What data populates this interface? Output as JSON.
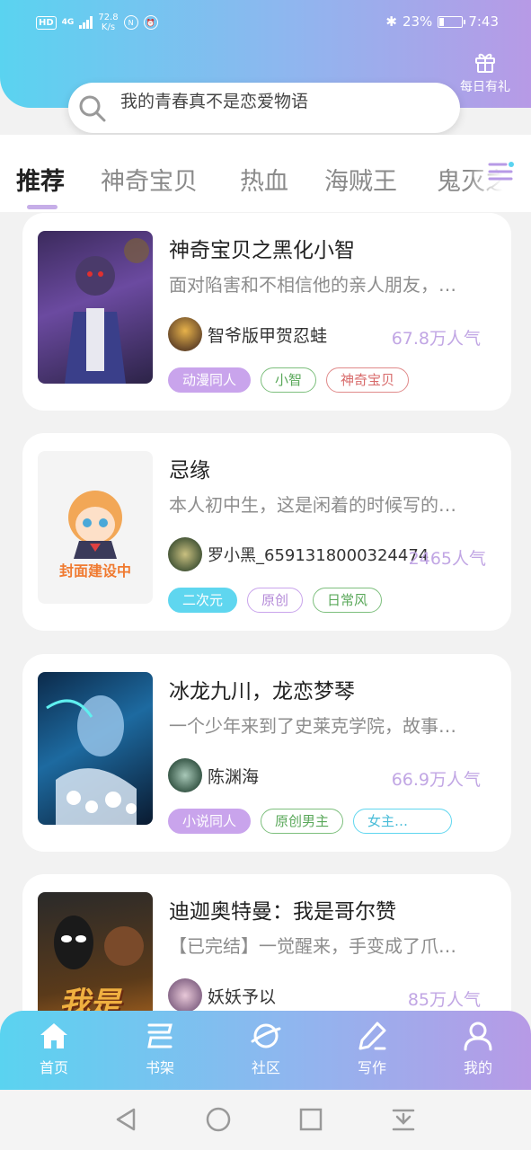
{
  "status_bar": {
    "network_badge": "HD",
    "network_type": "4G",
    "speed_value": "72.8",
    "speed_unit": "K/s",
    "battery": "23%",
    "time": "7:43"
  },
  "header": {
    "gift_label": "每日有礼"
  },
  "search": {
    "placeholder": "我的青春真不是恋爱物语"
  },
  "tabs": [
    {
      "label": "推荐",
      "active": true
    },
    {
      "label": "神奇宝贝",
      "active": false
    },
    {
      "label": "热血",
      "active": false
    },
    {
      "label": "海贼王",
      "active": false
    },
    {
      "label": "鬼灭之刃",
      "active": false
    }
  ],
  "books": [
    {
      "title": "神奇宝贝之黑化小智",
      "desc": "面对陷害和不相信他的亲人朋友，…",
      "author": "智爷版甲贺忍蛙",
      "popularity": "67.8万人气",
      "tags": [
        {
          "label": "动漫同人",
          "style": "fill-purple"
        },
        {
          "label": "小智",
          "style": "out-green"
        },
        {
          "label": "神奇宝贝",
          "style": "out-red"
        }
      ]
    },
    {
      "title": "忌缘",
      "desc": "本人初中生，这是闲着的时候写的…",
      "author": "罗小黑_6591318000324474",
      "popularity": "2465人气",
      "cover_text": "封面建设中",
      "tags": [
        {
          "label": "二次元",
          "style": "fill-cyan"
        },
        {
          "label": "原创",
          "style": "out-purple"
        },
        {
          "label": "日常风",
          "style": "out-green"
        }
      ]
    },
    {
      "title": "冰龙九川，龙恋梦琴",
      "desc": "一个少年来到了史莱克学院，故事…",
      "author": "陈渊海",
      "popularity": "66.9万人气",
      "tags": [
        {
          "label": "小说同人",
          "style": "fill-purple"
        },
        {
          "label": "原创男主",
          "style": "out-green"
        },
        {
          "label": "女主…",
          "style": "out-cyan"
        }
      ]
    },
    {
      "title": "迪迦奥特曼：我是哥尔赞",
      "desc": "【已完结】一觉醒来，手变成了爪…",
      "author": "妖妖予以",
      "popularity": "85万人气",
      "cover_text": "我是",
      "tags": []
    }
  ],
  "bottom_nav": [
    {
      "label": "首页",
      "icon": "home-icon"
    },
    {
      "label": "书架",
      "icon": "bookshelf-icon"
    },
    {
      "label": "社区",
      "icon": "planet-icon"
    },
    {
      "label": "写作",
      "icon": "pen-icon"
    },
    {
      "label": "我的",
      "icon": "user-icon"
    }
  ],
  "colors": {
    "gradient_start": "#5ad3f0",
    "gradient_end": "#b79ae6",
    "popularity": "#c1a6e4"
  }
}
